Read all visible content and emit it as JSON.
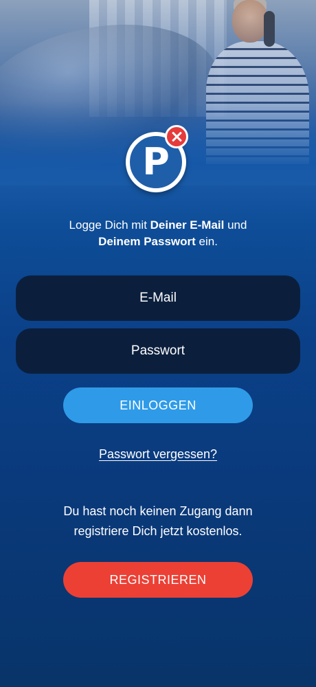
{
  "intro": {
    "part1": "Logge Dich mit ",
    "bold1": "Deiner E-Mail",
    "part2": " und ",
    "bold2": "Deinem Passwort",
    "part3": " ein."
  },
  "login_form": {
    "email_placeholder": "E-Mail",
    "password_placeholder": "Passwort",
    "login_button": "EINLOGGEN",
    "forgot_link": "Passwort vergessen?"
  },
  "signup": {
    "line1": "Du hast noch keinen Zugang dann",
    "line2": "registriere Dich jetzt kostenlos.",
    "register_button": "REGISTRIEREN"
  },
  "logo": {
    "letter": "P"
  },
  "colors": {
    "primary_blue": "#1a5ba8",
    "input_bg": "#0b1f3d",
    "login_button": "#2f9be8",
    "register_button": "#ec4035",
    "badge_red": "#e63b3b"
  },
  "icons": {
    "logo": "parking-p-icon",
    "badge": "no-parking-x-icon"
  }
}
